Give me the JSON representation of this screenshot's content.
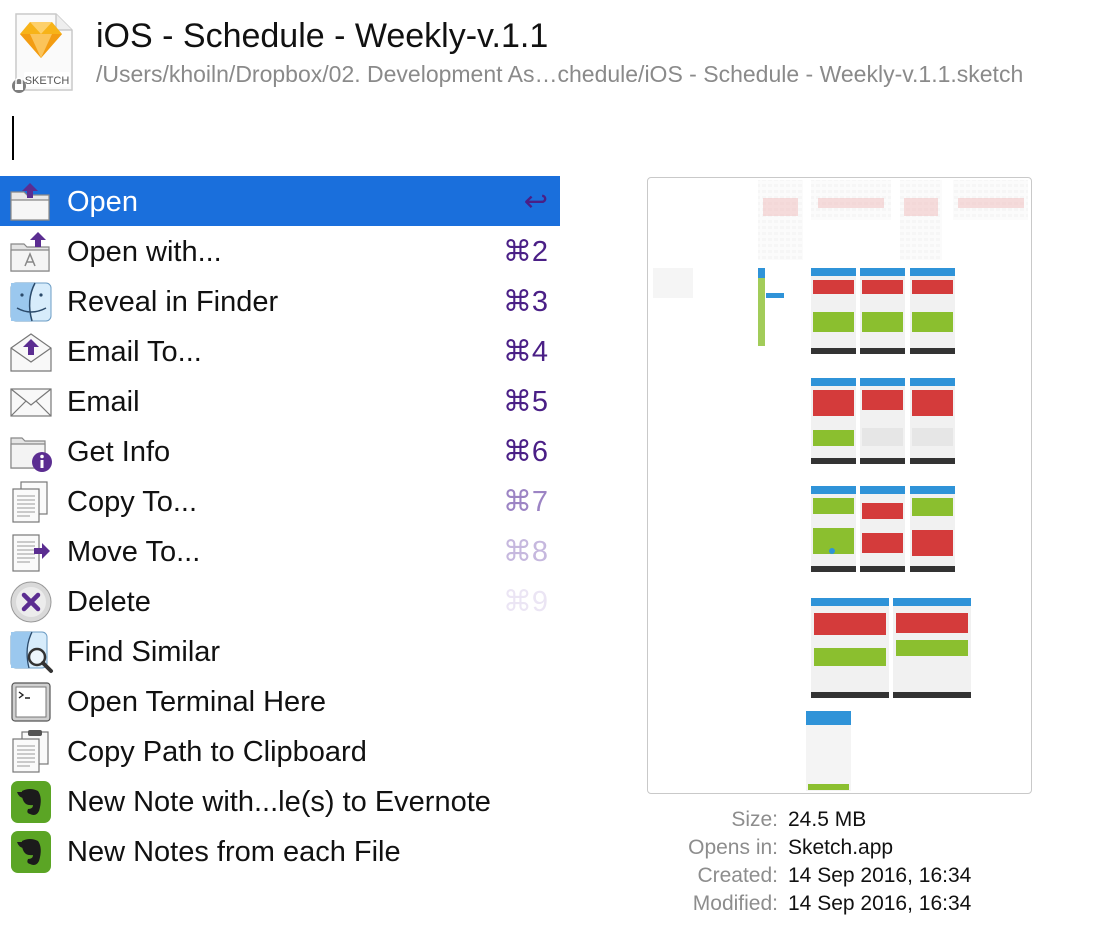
{
  "header": {
    "title": "iOS - Schedule - Weekly-v.1.1",
    "path": "/Users/khoiln/Dropbox/02. Development As…chedule/iOS - Schedule - Weekly-v.1.1.sketch",
    "file_icon": "sketch-document-icon",
    "file_icon_label": "SKETCH"
  },
  "search": {
    "value": ""
  },
  "menu": {
    "items": [
      {
        "name": "open",
        "label": "Open",
        "shortcut": "↩",
        "icon": "folder-open-icon",
        "shortcut_color": "#4a1f86",
        "selected": true
      },
      {
        "name": "open-with",
        "label": "Open with...",
        "shortcut": "⌘2",
        "icon": "app-store-folder-icon",
        "shortcut_color": "#4a1f86"
      },
      {
        "name": "reveal-in-finder",
        "label": "Reveal in Finder",
        "shortcut": "⌘3",
        "icon": "finder-icon",
        "shortcut_color": "#4a1f86"
      },
      {
        "name": "email-to",
        "label": "Email To...",
        "shortcut": "⌘4",
        "icon": "envelope-upload-icon",
        "shortcut_color": "#4a1f86"
      },
      {
        "name": "email",
        "label": "Email",
        "shortcut": "⌘5",
        "icon": "envelope-icon",
        "shortcut_color": "#4a1f86"
      },
      {
        "name": "get-info",
        "label": "Get Info",
        "shortcut": "⌘6",
        "icon": "info-folder-icon",
        "shortcut_color": "#4a1f86"
      },
      {
        "name": "copy-to",
        "label": "Copy To...",
        "shortcut": "⌘7",
        "icon": "copy-documents-icon",
        "shortcut_color": "#9c84c4"
      },
      {
        "name": "move-to",
        "label": "Move To...",
        "shortcut": "⌘8",
        "icon": "move-document-icon",
        "shortcut_color": "#c6b8de"
      },
      {
        "name": "delete",
        "label": "Delete",
        "shortcut": "⌘9",
        "icon": "delete-x-icon",
        "shortcut_color": "#ebe5f4"
      },
      {
        "name": "find-similar",
        "label": "Find Similar",
        "shortcut": "",
        "icon": "finder-magnifier-icon"
      },
      {
        "name": "open-terminal-here",
        "label": "Open Terminal Here",
        "shortcut": "",
        "icon": "terminal-icon"
      },
      {
        "name": "copy-path-to-clipboard",
        "label": "Copy Path to Clipboard",
        "shortcut": "",
        "icon": "clipboard-icon"
      },
      {
        "name": "new-note-to-evernote",
        "label": "New Note with...le(s) to Evernote",
        "shortcut": "",
        "icon": "evernote-icon"
      },
      {
        "name": "new-notes-from-each-file",
        "label": "New Notes from each File",
        "shortcut": "",
        "icon": "evernote-icon"
      }
    ]
  },
  "preview": {
    "icon": "sketch-artboards-thumbnail"
  },
  "info": [
    {
      "key": "Size:",
      "value": "24.5 MB"
    },
    {
      "key": "Opens in:",
      "value": "Sketch.app"
    },
    {
      "key": "Created:",
      "value": "14 Sep 2016, 16:34"
    },
    {
      "key": "Modified:",
      "value": "14 Sep 2016, 16:34"
    }
  ],
  "colors": {
    "selection": "#1a6fdc",
    "shortcut_purple": "#4a1f86",
    "path_gray": "#8a8a8a",
    "thumb_blue": "#2f93d8",
    "thumb_red": "#d43b3b",
    "thumb_green": "#8bbf2f"
  }
}
